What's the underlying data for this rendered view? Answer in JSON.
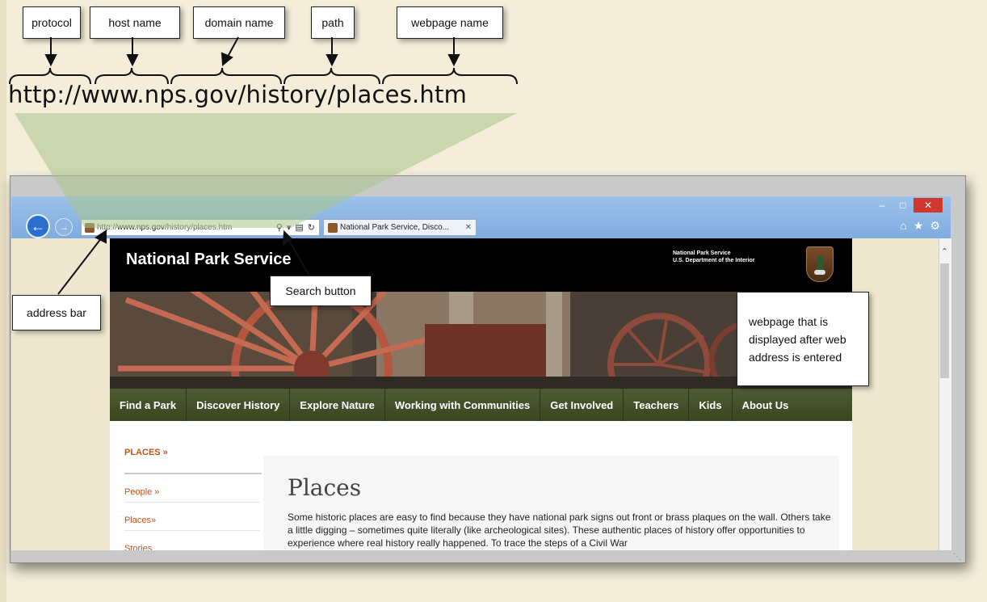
{
  "labels": {
    "protocol": "protocol",
    "host_name": "host name",
    "domain_name": "domain name",
    "path": "path",
    "webpage_name": "webpage name",
    "address_bar": "address bar",
    "search_button": "Search button",
    "webpage_displayed": "webpage that is displayed after web address is entered"
  },
  "url_display": "http://www.nps.gov/history/places.htm",
  "browser": {
    "address_prefix": "http://",
    "address_host": "www.nps.gov",
    "address_path": "/history/places.htm",
    "tab_title": "National Park Service, Disco...",
    "icons": [
      "back-arrow-icon",
      "forward-arrow-icon",
      "search-icon",
      "dropdown-icon",
      "compatibility-icon",
      "refresh-icon",
      "close-icon",
      "home-icon",
      "favorites-star-icon",
      "settings-gear-icon"
    ]
  },
  "site": {
    "title": "National Park Service",
    "agency_line1": "National Park Service",
    "agency_line2": "U.S. Department of the Interior",
    "nav": [
      "Find a Park",
      "Discover History",
      "Explore Nature",
      "Working with Communities",
      "Get Involved",
      "Teachers",
      "Kids",
      "About Us"
    ],
    "breadcrumb": "PLACES »",
    "sidebar": [
      "People »",
      "Places»",
      "Stories"
    ],
    "heading": "Places",
    "body": "Some historic places are easy to find because they have national park signs out front or brass plaques on the wall. Others take a little digging – sometimes quite literally (like archeological sites). These authentic places of history offer opportunities to experience where real history really happened. To trace the steps of a Civil War"
  },
  "colors": {
    "background": "#f3edd9",
    "window_frame": "#7fabde",
    "nps_nav": "#4e5c35",
    "link_orange": "#c0531e"
  }
}
